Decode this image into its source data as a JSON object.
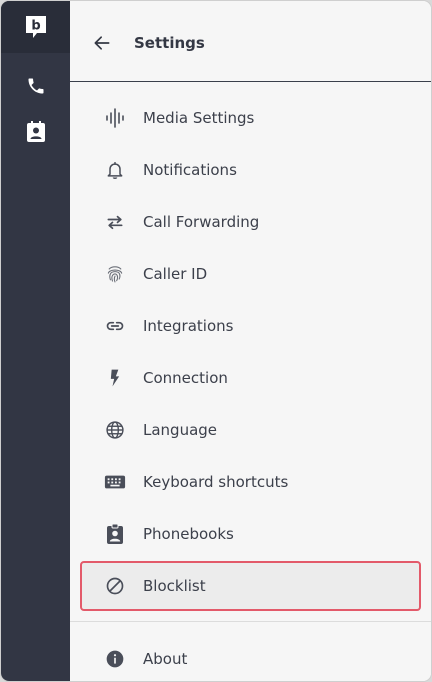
{
  "app": {
    "logo_letter": "b",
    "accent_color": "#e35a6a",
    "rail_color": "#323644"
  },
  "rail": {
    "items": [
      {
        "icon": "phone-icon"
      },
      {
        "icon": "contacts-icon"
      }
    ]
  },
  "header": {
    "title": "Settings",
    "back_icon": "arrow-left-icon"
  },
  "menu": {
    "items": [
      {
        "label": "Media Settings",
        "icon": "audio-waveform-icon"
      },
      {
        "label": "Notifications",
        "icon": "bell-icon"
      },
      {
        "label": "Call Forwarding",
        "icon": "swap-arrows-icon"
      },
      {
        "label": "Caller ID",
        "icon": "fingerprint-icon"
      },
      {
        "label": "Integrations",
        "icon": "link-icon"
      },
      {
        "label": "Connection",
        "icon": "lightning-bolt-icon"
      },
      {
        "label": "Language",
        "icon": "globe-icon"
      },
      {
        "label": "Keyboard shortcuts",
        "icon": "keyboard-icon"
      },
      {
        "label": "Phonebooks",
        "icon": "contact-book-icon"
      },
      {
        "label": "Blocklist",
        "icon": "block-icon",
        "selected": true
      }
    ]
  },
  "footer": {
    "about": {
      "label": "About",
      "icon": "info-icon"
    }
  }
}
